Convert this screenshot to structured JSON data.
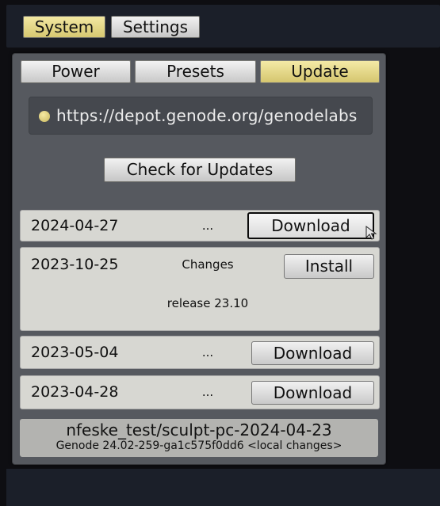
{
  "menubar": {
    "system_label": "System",
    "settings_label": "Settings"
  },
  "tabs": [
    {
      "label": "Power",
      "active": false
    },
    {
      "label": "Presets",
      "active": false
    },
    {
      "label": "Update",
      "active": true
    }
  ],
  "depot": {
    "url": "https://depot.genode.org/genodelabs",
    "status_icon": "status-dot-icon"
  },
  "check_button_label": "Check for Updates",
  "versions": [
    {
      "date": "2024-04-27",
      "info": "...",
      "action": "Download",
      "focused": true
    },
    {
      "date": "2023-10-25",
      "info": "Changes",
      "notes": "release 23.10",
      "action": "Install",
      "focused": false
    },
    {
      "date": "2023-05-04",
      "info": "...",
      "action": "Download",
      "focused": false
    },
    {
      "date": "2023-04-28",
      "info": "...",
      "action": "Download",
      "focused": false
    }
  ],
  "current_system": {
    "image": "nfeske_test/sculpt-pc-2024-04-23",
    "version": "Genode 24.02-259-ga1c575f0dd6 <local changes>"
  },
  "colors": {
    "accent_active": "#e4d78a",
    "panel": "#56595f",
    "row_bg": "#d7d7d2",
    "background": "#0e0e12"
  }
}
